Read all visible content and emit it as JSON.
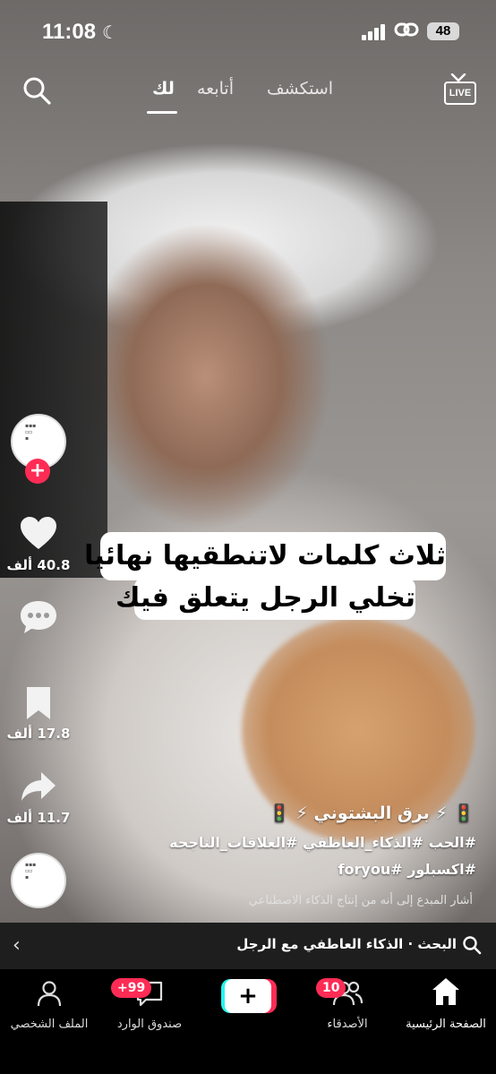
{
  "status_bar": {
    "time": "11:08",
    "battery": "48"
  },
  "top_nav": {
    "tabs": [
      {
        "label": "لك",
        "active": true
      },
      {
        "label": "أتابعه",
        "active": false
      },
      {
        "label": "استكشف",
        "active": false
      }
    ],
    "live_label": "LIVE"
  },
  "caption": {
    "line1": "ثلاث كلمات لاتنطقيها نهائيا",
    "line2": "تخلي الرجل يتعلق فيك"
  },
  "side_actions": {
    "likes": "40.8 ألف",
    "bookmarks": "17.8 ألف",
    "shares": "11.7 ألف"
  },
  "video_info": {
    "author": "🚦 ⚡ برق البشتوني ⚡ 🚦",
    "hashtags_line1": "#الحب #الذكاء_العاطفي #العلاقات_الناجحه",
    "hashtags_line2": "#اكسبلور #foryou",
    "ai_note": "أشار المبدع إلى أنه من إنتاج الذكاء الاصطناعي"
  },
  "search_bar": {
    "text": "البحث · الذكاء العاطفي مع الرجل"
  },
  "bottom_nav": {
    "home": "الصفحة الرئيسية",
    "friends": "الأصدقاء",
    "friends_badge": "10",
    "create": "+",
    "inbox": "صندوق الوارد",
    "inbox_badge": "+99",
    "profile": "الملف الشخصي"
  },
  "colors": {
    "accent": "#fe2c55",
    "cyan": "#25f4ee"
  }
}
